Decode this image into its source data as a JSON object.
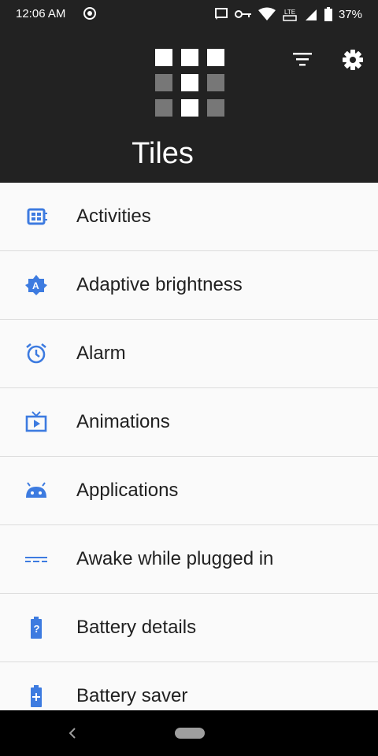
{
  "status_bar": {
    "time": "12:06 AM",
    "battery_pct": "37%",
    "volte_badge": "LTE"
  },
  "header": {
    "title": "Tiles",
    "icons": [
      "tiles-logo-icon",
      "filter-icon",
      "settings-gear-icon"
    ]
  },
  "accent_color": "#3d7be0",
  "tiles": [
    {
      "label": "Activities",
      "icon": "activities-icon"
    },
    {
      "label": "Adaptive brightness",
      "icon": "adaptive-brightness-icon"
    },
    {
      "label": "Alarm",
      "icon": "alarm-clock-icon"
    },
    {
      "label": "Animations",
      "icon": "tv-play-icon"
    },
    {
      "label": "Applications",
      "icon": "android-icon"
    },
    {
      "label": "Awake while plugged in",
      "icon": "dashes-icon"
    },
    {
      "label": "Battery details",
      "icon": "battery-question-icon"
    },
    {
      "label": "Battery saver",
      "icon": "battery-plus-icon"
    }
  ]
}
